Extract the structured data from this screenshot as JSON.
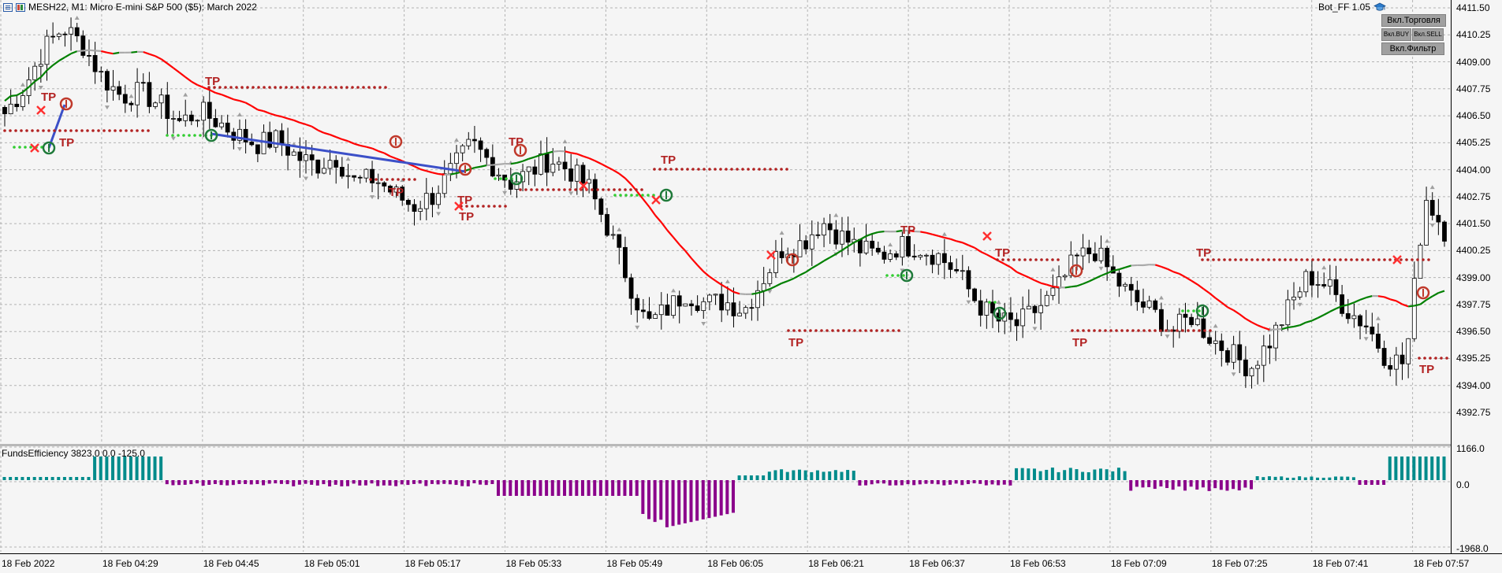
{
  "header": {
    "symbol_line": "MESH22, M1:  Micro E-mini S&P 500 ($5): March 2022"
  },
  "bot": {
    "name": "Bot_FF 1.05",
    "buttons": {
      "trade_toggle": "Вкл.Торговля",
      "buy_toggle": "Вкл.BUY",
      "sell_toggle": "Вкл.SELL",
      "filter_toggle": "Вкл.Фильтр"
    }
  },
  "indicator": {
    "label": "FundsEfficiency 3823.0 0.0 -125.0",
    "scale_top": "1166.0",
    "scale_zero": "0.0",
    "scale_bottom": "-1968.0"
  },
  "price_scale": [
    "4411.50",
    "4410.25",
    "4409.00",
    "4407.75",
    "4406.50",
    "4405.25",
    "4404.00",
    "4402.75",
    "4401.50",
    "4400.25",
    "4399.00",
    "4397.75",
    "4396.50",
    "4395.25",
    "4394.00",
    "4392.75"
  ],
  "time_scale": [
    "18 Feb 2022",
    "18 Feb 04:29",
    "18 Feb 04:45",
    "18 Feb 05:01",
    "18 Feb 05:17",
    "18 Feb 05:33",
    "18 Feb 05:49",
    "18 Feb 06:05",
    "18 Feb 06:21",
    "18 Feb 06:37",
    "18 Feb 06:53",
    "18 Feb 07:09",
    "18 Feb 07:25",
    "18 Feb 07:41",
    "18 Feb 07:57"
  ],
  "tp_label": "TP",
  "colors": {
    "bull": "#ffffff",
    "bear": "#000000",
    "ma_down": "#ff0000",
    "ma_flat": "#a9a9a9",
    "ma_up": "#008000",
    "tp_dots": "#b22222",
    "entry_dots": "#32cd32",
    "trend_line": "#3c50c8",
    "hist_pos": "#008b8b",
    "hist_neg": "#8b008b",
    "close_marker": "#ff3030"
  },
  "chart_data": {
    "type": "candlestick",
    "symbol": "MESH22",
    "timeframe": "M1",
    "y_range": [
      4391.5,
      4412.0
    ],
    "close_path": [
      4406.6,
      4407.8,
      4409.6,
      4410.6,
      4409.8,
      4408.3,
      4407.4,
      4407.6,
      4407.0,
      4406.2,
      4406.7,
      4406.2,
      4405.6,
      4405.2,
      4405.4,
      4404.6,
      4404.2,
      4404.6,
      4403.4,
      4403.6,
      4402.9,
      4402.3,
      4402.8,
      4404.0,
      4405.2,
      4404.3,
      4403.4,
      4403.9,
      4404.5,
      4404.0,
      4403.2,
      4401.3,
      4399.0,
      4396.8,
      4397.5,
      4398.3,
      4397.8,
      4397.9,
      4397.5,
      4399.0,
      4400.4,
      4400.6,
      4401.6,
      4400.9,
      4400.3,
      4400.0,
      4400.5,
      4400.4,
      4400.0,
      4399.2,
      4397.8,
      4397.0,
      4396.8,
      4397.5,
      4398.3,
      4399.8,
      4400.3,
      4399.0,
      4398.0,
      4397.4,
      4396.5,
      4397.2,
      4396.2,
      4395.5,
      4394.8,
      4396.0,
      4397.6,
      4399.1,
      4398.6,
      4397.5,
      4396.8,
      4395.3,
      4395.0,
      4402.8,
      4401.2
    ],
    "ma_trend": "falling",
    "indicator_hist_range": [
      -1968,
      1166
    ]
  }
}
